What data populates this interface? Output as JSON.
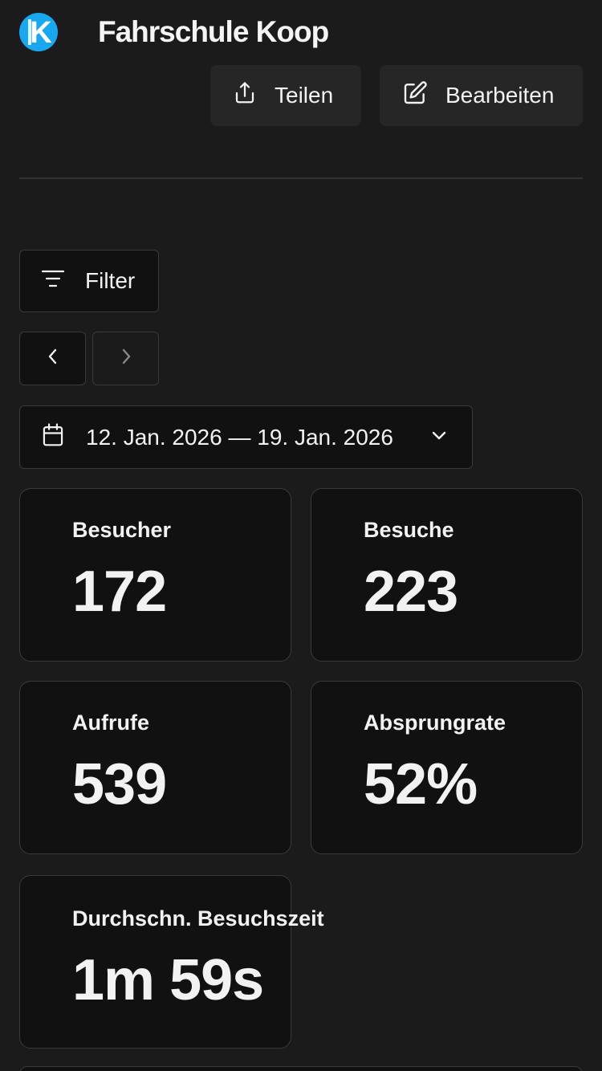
{
  "header": {
    "site_title": "Fahrschule Koop",
    "logo_letter": "K",
    "logo_color": "#19a8f0"
  },
  "toolbar": {
    "share_label": "Teilen",
    "share_icon": "share-upload-icon",
    "edit_label": "Bearbeiten",
    "edit_icon": "edit-pencil-icon"
  },
  "filter": {
    "label": "Filter",
    "icon": "filter-lines-icon"
  },
  "date_nav": {
    "prev_icon": "chevron-left-icon",
    "next_icon": "chevron-right-icon"
  },
  "date_range": {
    "icon": "calendar-icon",
    "text": "12. Jan. 2026 — 19. Jan. 2026",
    "dropdown_icon": "chevron-down-icon"
  },
  "metrics": [
    {
      "label": "Besucher",
      "value": "172"
    },
    {
      "label": "Besuche",
      "value": "223"
    },
    {
      "label": "Aufrufe",
      "value": "539"
    },
    {
      "label": "Absprungrate",
      "value": "52%"
    },
    {
      "label": "Durchschn. Besuchszeit",
      "value": "1m 59s"
    }
  ],
  "colors": {
    "background": "#1b1b1b",
    "card_background": "#111111",
    "border": "#3a3a3a",
    "button_background": "#262626",
    "text": "#f2f2f2"
  }
}
